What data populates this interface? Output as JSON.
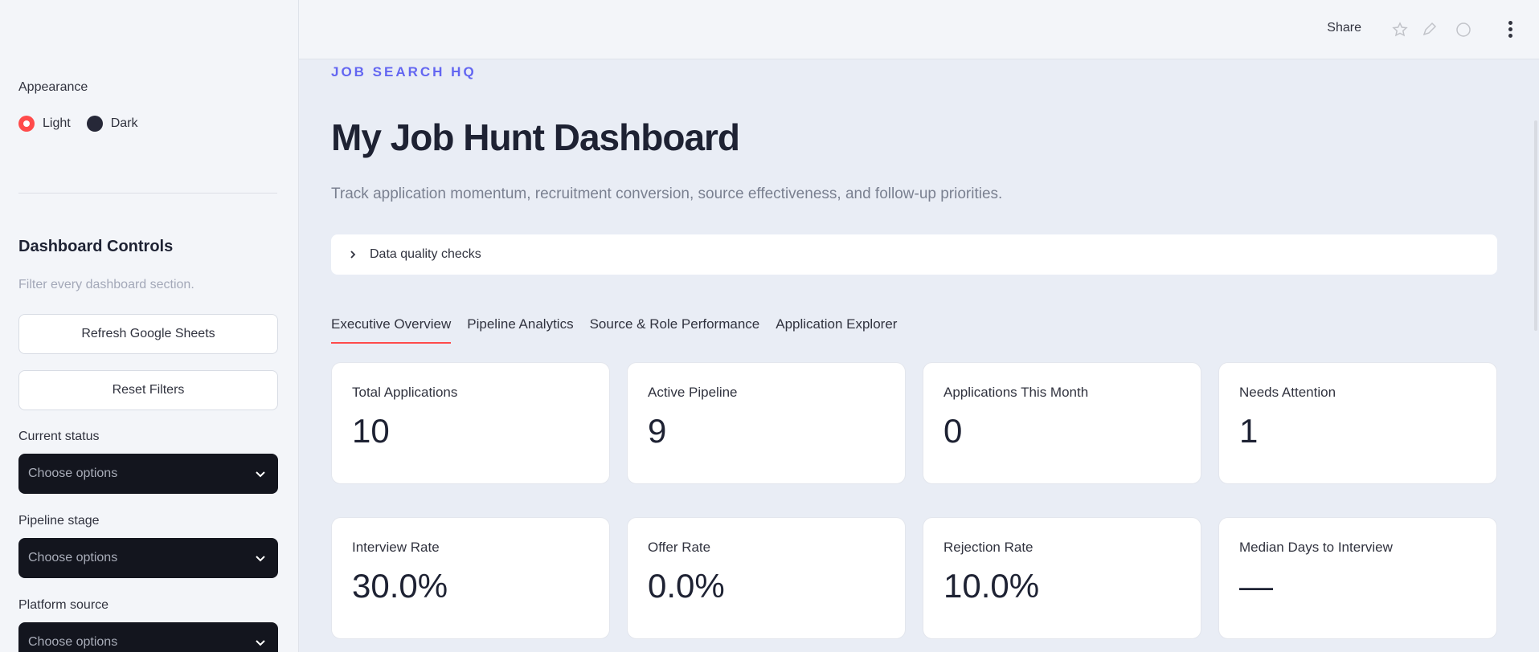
{
  "sidebar": {
    "appearance_label": "Appearance",
    "appearance_options": [
      "Light",
      "Dark"
    ],
    "appearance_selected": "Light",
    "controls_title": "Dashboard Controls",
    "controls_subtitle": "Filter every dashboard section.",
    "refresh_button": "Refresh Google Sheets",
    "reset_button": "Reset Filters",
    "filters": [
      {
        "label": "Current status",
        "placeholder": "Choose options"
      },
      {
        "label": "Pipeline stage",
        "placeholder": "Choose options"
      },
      {
        "label": "Platform source",
        "placeholder": "Choose options"
      }
    ]
  },
  "header": {
    "share_label": "Share"
  },
  "main": {
    "eyebrow": "JOB SEARCH HQ",
    "title": "My Job Hunt Dashboard",
    "subtitle": "Track application momentum, recruitment conversion, source effectiveness, and follow-up priorities.",
    "expander_label": "Data quality checks",
    "tabs": [
      "Executive Overview",
      "Pipeline Analytics",
      "Source & Role Performance",
      "Application Explorer"
    ],
    "active_tab": "Executive Overview",
    "metrics": [
      {
        "label": "Total Applications",
        "value": "10"
      },
      {
        "label": "Active Pipeline",
        "value": "9"
      },
      {
        "label": "Applications This Month",
        "value": "0"
      },
      {
        "label": "Needs Attention",
        "value": "1"
      },
      {
        "label": "Interview Rate",
        "value": "30.0%"
      },
      {
        "label": "Offer Rate",
        "value": "0.0%"
      },
      {
        "label": "Rejection Rate",
        "value": "10.0%"
      },
      {
        "label": "Median Days to Interview",
        "value": "—"
      }
    ]
  },
  "colors": {
    "accent": "#ff4b4b",
    "eyebrow": "#6366f1",
    "select_bg": "#13151e"
  }
}
